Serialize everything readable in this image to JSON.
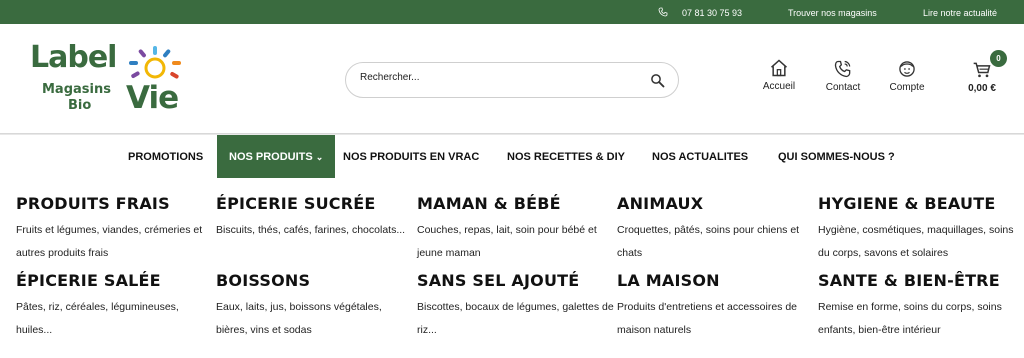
{
  "topbar": {
    "phone": "07 81 30 75 93",
    "stores_link": "Trouver nos magasins",
    "news_link": "Lire notre actualité"
  },
  "logo": {
    "word_label": "Label",
    "word_magasins": "Magasins",
    "word_bio": "Bio",
    "word_vie": "Vie"
  },
  "search": {
    "placeholder": "Rechercher..."
  },
  "header_nav": {
    "home": "Accueil",
    "contact": "Contact",
    "account": "Compte",
    "cart_total": "0,00 €",
    "cart_count": "0"
  },
  "main_nav": {
    "promotions": "PROMOTIONS",
    "products": "NOS PRODUITS",
    "bulk": "NOS PRODUITS EN VRAC",
    "recipes": "NOS RECETTES & DIY",
    "news": "NOS ACTUALITES",
    "about": "QUI SOMMES-NOUS ?"
  },
  "categories": [
    {
      "title": "PRODUITS FRAIS",
      "desc": "Fruits et légumes, viandes, crémeries et autres produits frais"
    },
    {
      "title": "ÉPICERIE SUCRÉE",
      "desc": "Biscuits, thés, cafés, farines, chocolats..."
    },
    {
      "title": "MAMAN & BÉBÉ",
      "desc": "Couches, repas, lait, soin pour bébé et jeune maman"
    },
    {
      "title": "ANIMAUX",
      "desc": "Croquettes, pâtés, soins pour chiens et chats"
    },
    {
      "title": "HYGIENE & BEAUTE",
      "desc": "Hygiène, cosmétiques, maquillages, soins du corps, savons et solaires"
    },
    {
      "title": "ÉPICERIE SALÉE",
      "desc": "Pâtes, riz, céréales, légumineuses, huiles..."
    },
    {
      "title": "BOISSONS",
      "desc": "Eaux, laits, jus, boissons végétales, bières, vins et sodas"
    },
    {
      "title": "SANS SEL AJOUTÉ",
      "desc": "Biscottes, bocaux de légumes, galettes de riz..."
    },
    {
      "title": "LA MAISON",
      "desc": "Produits d'entretiens et accessoires de maison naturels"
    },
    {
      "title": "SANTE & BIEN-ÊTRE",
      "desc": "Remise en forme, soins du corps, soins enfants, bien-être intérieur"
    }
  ],
  "colors": {
    "brand_green": "#3a6b3f",
    "sun_yellow": "#f2b705",
    "sun_orange": "#f08a1c",
    "sun_red": "#d9452b",
    "sun_blue": "#2f7fc1",
    "sun_purple": "#7b4aa0",
    "sun_lightblue": "#55b6e6"
  },
  "icons": [
    "phone-icon",
    "search-icon",
    "home-icon",
    "contact-phone-icon",
    "account-icon",
    "cart-icon",
    "chevron-down-icon",
    "sun-logo-icon"
  ]
}
